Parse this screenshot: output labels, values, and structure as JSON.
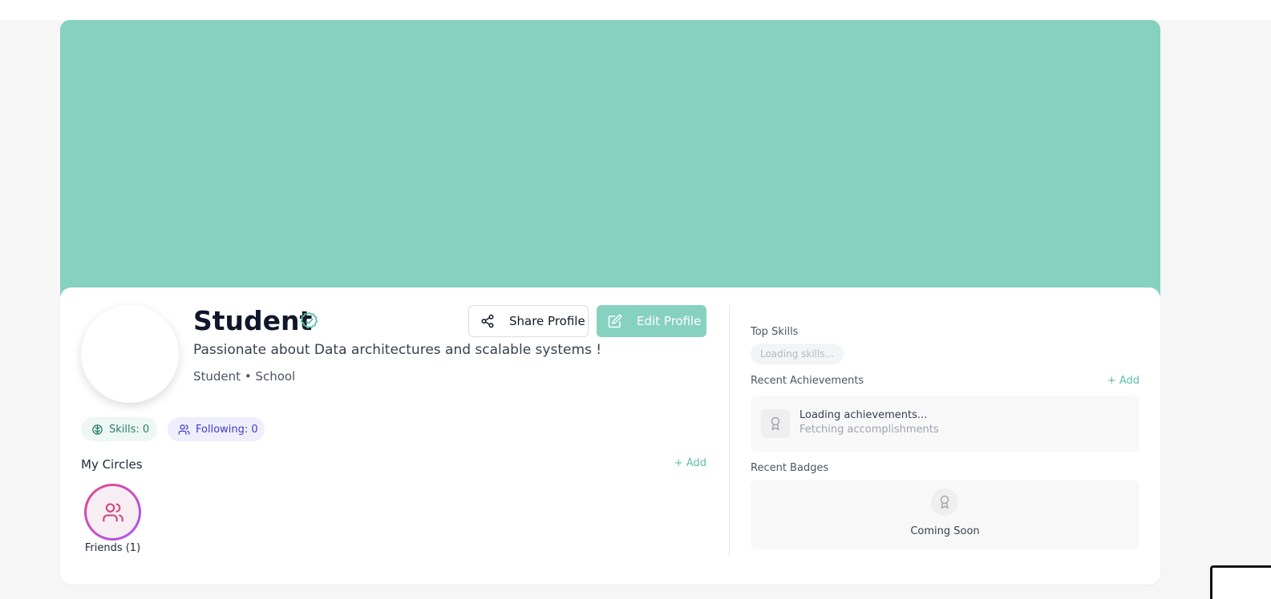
{
  "profile": {
    "name": "Student",
    "bio": "Passionate about Data architectures and scalable systems !",
    "meta": "Student • School"
  },
  "actions": {
    "share_label": "Share Profile",
    "edit_label": "Edit Profile"
  },
  "stats": {
    "skills": "Skills: 0",
    "following": "Following: 0"
  },
  "circles": {
    "title": "My Circles",
    "add_label": "+ Add",
    "items": [
      {
        "label": "Friends (1)",
        "icon": "users-icon"
      }
    ]
  },
  "sidebar": {
    "top_skills": {
      "title": "Top Skills",
      "loading": "Loading skills..."
    },
    "achievements": {
      "title": "Recent Achievements",
      "add_label": "+ Add",
      "loading_title": "Loading achievements...",
      "loading_sub": "Fetching accomplishments"
    },
    "badges": {
      "title": "Recent Badges",
      "status": "Coming Soon"
    }
  },
  "colors": {
    "cover": "#86d1bf",
    "accent": "#5cbfa7",
    "following": "#4338ca",
    "circle_gradient_start": "#e34a8c",
    "circle_gradient_end": "#a855f7"
  }
}
